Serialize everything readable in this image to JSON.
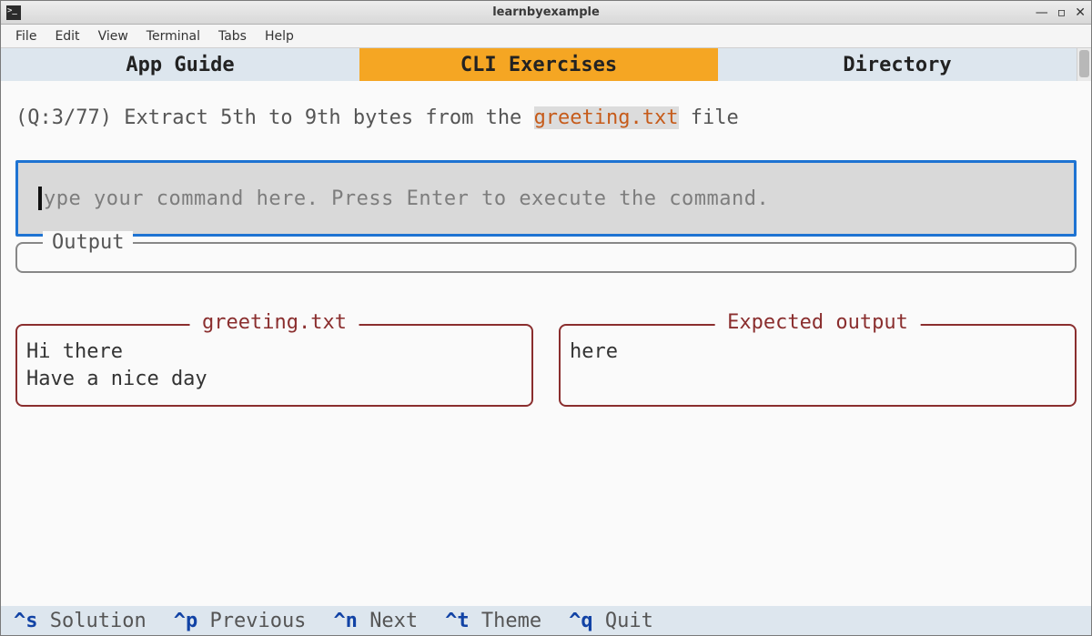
{
  "window": {
    "title": "learnbyexample"
  },
  "menubar": {
    "items": [
      "File",
      "Edit",
      "View",
      "Terminal",
      "Tabs",
      "Help"
    ]
  },
  "tabs": {
    "items": [
      "App Guide",
      "CLI Exercises",
      "Directory"
    ],
    "active_index": 1
  },
  "question": {
    "counter": "(Q:3/77)",
    "before_file": " Extract 5th to 9th bytes from the ",
    "filename": "greeting.txt",
    "after_file": " file"
  },
  "command_input": {
    "value": "",
    "placeholder": "ype your command here. Press Enter to execute the command."
  },
  "output": {
    "legend": "Output",
    "value": ""
  },
  "panels": {
    "source": {
      "legend": "greeting.txt",
      "body": "Hi there\nHave a nice day"
    },
    "expected": {
      "legend": "Expected output",
      "body": "here"
    }
  },
  "footer": {
    "shortcuts": [
      {
        "key": "^s",
        "label": "Solution"
      },
      {
        "key": "^p",
        "label": "Previous"
      },
      {
        "key": "^n",
        "label": "Next"
      },
      {
        "key": "^t",
        "label": "Theme"
      },
      {
        "key": "^q",
        "label": "Quit"
      }
    ]
  }
}
